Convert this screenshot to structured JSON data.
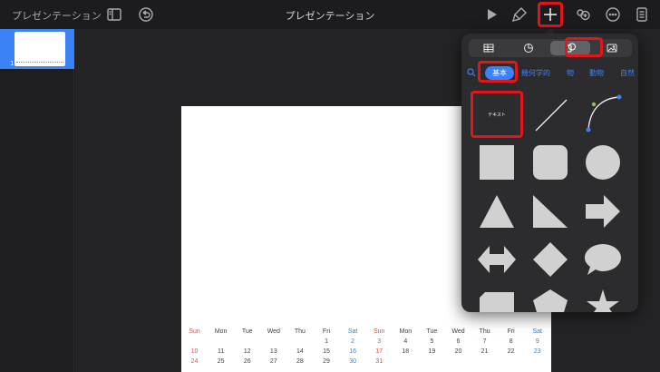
{
  "toolbar": {
    "doc_title": "プレゼンテーション",
    "center_title": "プレゼンテーション"
  },
  "sidebar": {
    "slide_number": "1"
  },
  "popover": {
    "tabs": [
      "table-icon",
      "chart-icon",
      "shapes-icon",
      "media-icon"
    ],
    "active_tab": "shapes-icon",
    "categories": {
      "active": "基本",
      "items": [
        "幾何学的",
        "物",
        "動物",
        "自然"
      ]
    },
    "text_tile_label": "テキスト"
  },
  "calendar": {
    "headers": [
      "Sun",
      "Mon",
      "Tue",
      "Wed",
      "Thu",
      "Fri",
      "Sat",
      "Sun",
      "Mon",
      "Tue",
      "Wed",
      "Thu",
      "Fri",
      "Sat"
    ],
    "rows": [
      [
        "",
        "",
        "",
        "",
        "",
        "1",
        "2",
        "3",
        "4",
        "5",
        "6",
        "7",
        "8",
        "9"
      ],
      [
        "10",
        "11",
        "12",
        "13",
        "14",
        "15",
        "16",
        "17",
        "18",
        "19",
        "20",
        "21",
        "22",
        "23"
      ],
      [
        "24",
        "25",
        "26",
        "27",
        "28",
        "29",
        "30",
        "31",
        "",
        "",
        "",
        "",
        "",
        ""
      ]
    ]
  },
  "colors": {
    "accent": "#3b82f6",
    "highlight": "#e0161b",
    "sunday": "#d9534f",
    "saturday": "#3a86c8"
  }
}
